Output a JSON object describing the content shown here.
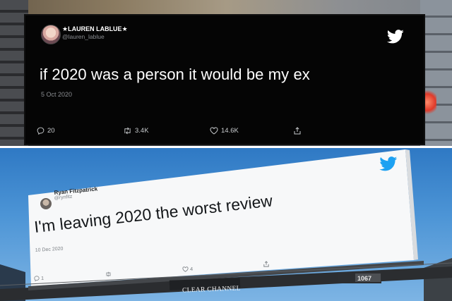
{
  "top_tweet": {
    "display_name": "★LAUREN LABLUE★",
    "handle": "@lauren_lablue",
    "text": "if 2020 was a person it would be my ex",
    "date": "5 Oct 2020",
    "replies": "20",
    "retweets": "3.4K",
    "likes": "14.6K",
    "logo": "twitter-bird-icon"
  },
  "bottom_tweet": {
    "display_name": "Ryan Fitzpatrick",
    "handle": "@rynfitz",
    "text": "I'm leaving 2020 the worst review",
    "date": "10 Dec 2020",
    "replies": "1",
    "likes": "4",
    "logo": "twitter-bird-icon"
  },
  "billboard": {
    "operator": "CLEAR CHANNEL",
    "panel_number": "1067"
  },
  "colors": {
    "twitter_blue": "#1DA1F2",
    "dark_board": "#050505",
    "sky": "#4d95d6"
  }
}
